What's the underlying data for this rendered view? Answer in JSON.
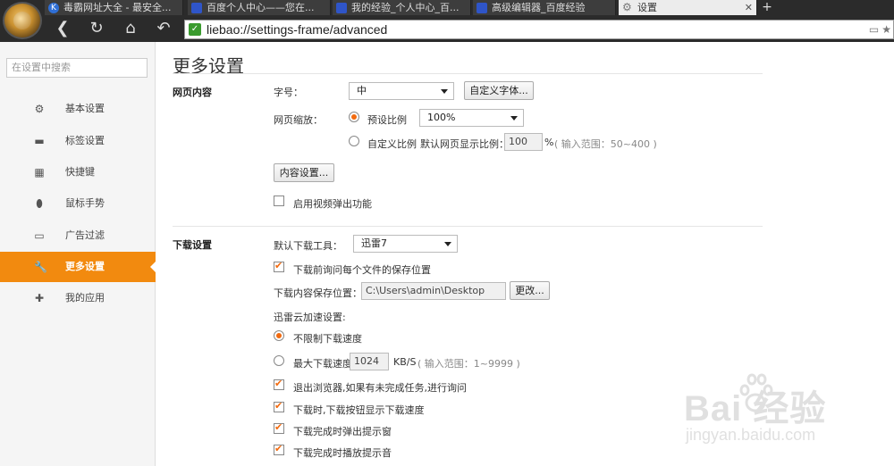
{
  "tabs": [
    {
      "title": "毒霸网址大全 - 最安全...",
      "icon_color": "#2f6fd6",
      "icon": "k-icon"
    },
    {
      "title": "百度个人中心——您在...",
      "icon_color": "#2f55c8",
      "icon": "baidu-paw-icon"
    },
    {
      "title": "我的经验_个人中心_百...",
      "icon_color": "#2f55c8",
      "icon": "baidu-paw-icon"
    },
    {
      "title": "高级编辑器_百度经验",
      "icon_color": "#2f55c8",
      "icon": "baidu-paw-icon"
    },
    {
      "title": "设置",
      "icon_color": "#888888",
      "icon": "gear-icon",
      "active": true
    }
  ],
  "toolbar": {
    "url": "liebao://settings-frame/advanced"
  },
  "sidebar": {
    "search_placeholder": "在设置中搜索",
    "items": [
      {
        "label": "基本设置",
        "icon": "gear-icon"
      },
      {
        "label": "标签设置",
        "icon": "tab-icon"
      },
      {
        "label": "快捷键",
        "icon": "keyboard-icon"
      },
      {
        "label": "鼠标手势",
        "icon": "mouse-icon"
      },
      {
        "label": "广告过滤",
        "icon": "window-icon"
      },
      {
        "label": "更多设置",
        "icon": "wrench-icon",
        "active": true
      },
      {
        "label": "我的应用",
        "icon": "puzzle-icon"
      }
    ]
  },
  "main": {
    "title": "更多设置",
    "web_content": {
      "section_label": "网页内容",
      "font_size_label": "字号：",
      "font_size_value": "中",
      "custom_font_button": "自定义字体...",
      "zoom_label": "网页缩放：",
      "preset_ratio_label": "预设比例",
      "preset_ratio_value": "100%",
      "custom_ratio_label": "自定义比例",
      "default_ratio_label": "默认网页显示比例：",
      "default_ratio_value": "100",
      "percent_unit": "%",
      "range_hint": "( 输入范围：50~400 )",
      "content_settings_button": "内容设置...",
      "video_popout_label": "启用视频弹出功能"
    },
    "download": {
      "section_label": "下载设置",
      "default_tool_label": "默认下载工具：",
      "default_tool_value": "迅雷7",
      "ask_location_label": "下载前询问每个文件的保存位置",
      "save_location_label": "下载内容保存位置：",
      "save_location_value": "C:\\Users\\admin\\Desktop",
      "change_button": "更改...",
      "xunlei_label": "迅雷云加速设置:",
      "unlimited_label": "不限制下载速度",
      "max_speed_label": "最大下载速度:",
      "max_speed_value": "1024",
      "speed_unit": "KB/S",
      "speed_range_hint": "( 输入范围：1~9999 )",
      "exit_ask_label": "退出浏览器,如果有未完成任务,进行询问",
      "show_speed_label": "下载时,下载按钮显示下载速度",
      "popup_done_label": "下载完成时弹出提示窗",
      "sound_done_label": "下载完成时播放提示音"
    }
  },
  "watermark": {
    "brand": "Bai  经验",
    "url": "jingyan.baidu.com"
  },
  "colors": {
    "accent": "#f28a0f",
    "chrome_dark": "#2b2b2b"
  }
}
